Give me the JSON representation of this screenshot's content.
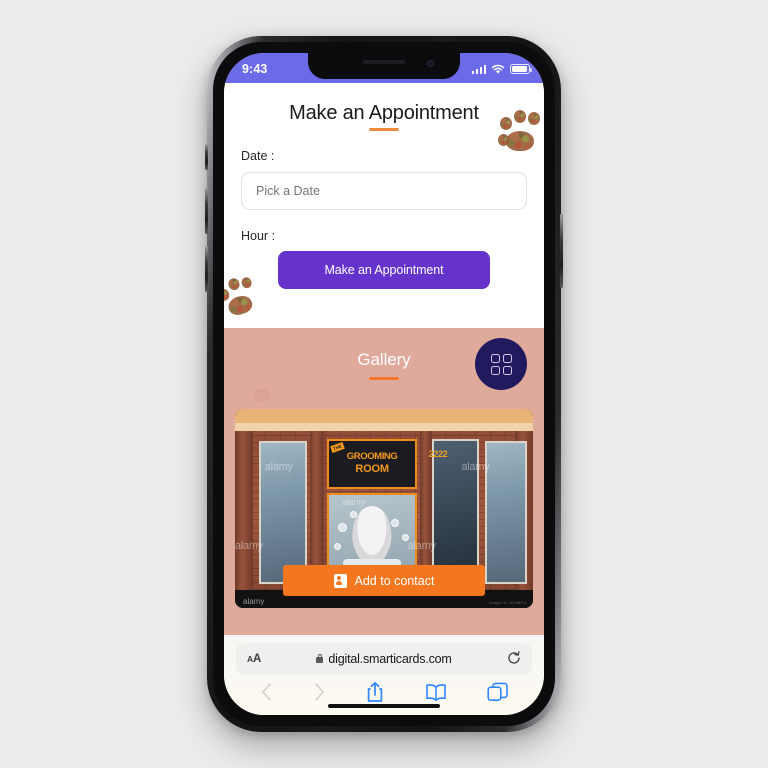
{
  "status_bar": {
    "time": "9:43",
    "icons": [
      "cellular-signal-icon",
      "wifi-icon",
      "battery-icon"
    ],
    "background_color": "#6b6be9"
  },
  "page": {
    "title": "Make an Appointment",
    "accent_color": "#f08a3c",
    "form": {
      "date_label": "Date :",
      "date_placeholder": "Pick a Date",
      "date_value": "",
      "hour_label": "Hour :",
      "submit_label": "Make an Appointment",
      "submit_color": "#6634cc"
    },
    "gallery": {
      "title": "Gallery",
      "underline_color": "#f2762b",
      "background_color": "#dfa99c",
      "grid_button_icon": "grid-2x2-icon",
      "grid_button_color": "#221a5e",
      "photo": {
        "alt": "The Grooming Room storefront",
        "sign_tag": "THE",
        "sign_line1": "GROOMING",
        "sign_line2": "ROOM",
        "house_number": "2222",
        "watermark": "alamy",
        "watermark_bottom": "alamy",
        "image_id": "Image ID: H2H8R4"
      },
      "add_to_contact_label": "Add to contact",
      "add_to_contact_color": "#f4761f",
      "add_to_contact_icon": "contact-card-icon"
    }
  },
  "browser": {
    "text_size_label_big": "A",
    "text_size_label_small": "A",
    "lock_icon": "lock-icon",
    "url": "digital.smarticards.com",
    "reload_icon": "reload-icon",
    "toolbar": [
      {
        "name": "back-button",
        "icon": "chevron-left-icon",
        "enabled": false
      },
      {
        "name": "forward-button",
        "icon": "chevron-right-icon",
        "enabled": false
      },
      {
        "name": "share-button",
        "icon": "share-icon",
        "enabled": true
      },
      {
        "name": "bookmarks-button",
        "icon": "book-icon",
        "enabled": true
      },
      {
        "name": "tabs-button",
        "icon": "tabs-icon",
        "enabled": true
      }
    ],
    "tint_color": "#2f86ff"
  }
}
